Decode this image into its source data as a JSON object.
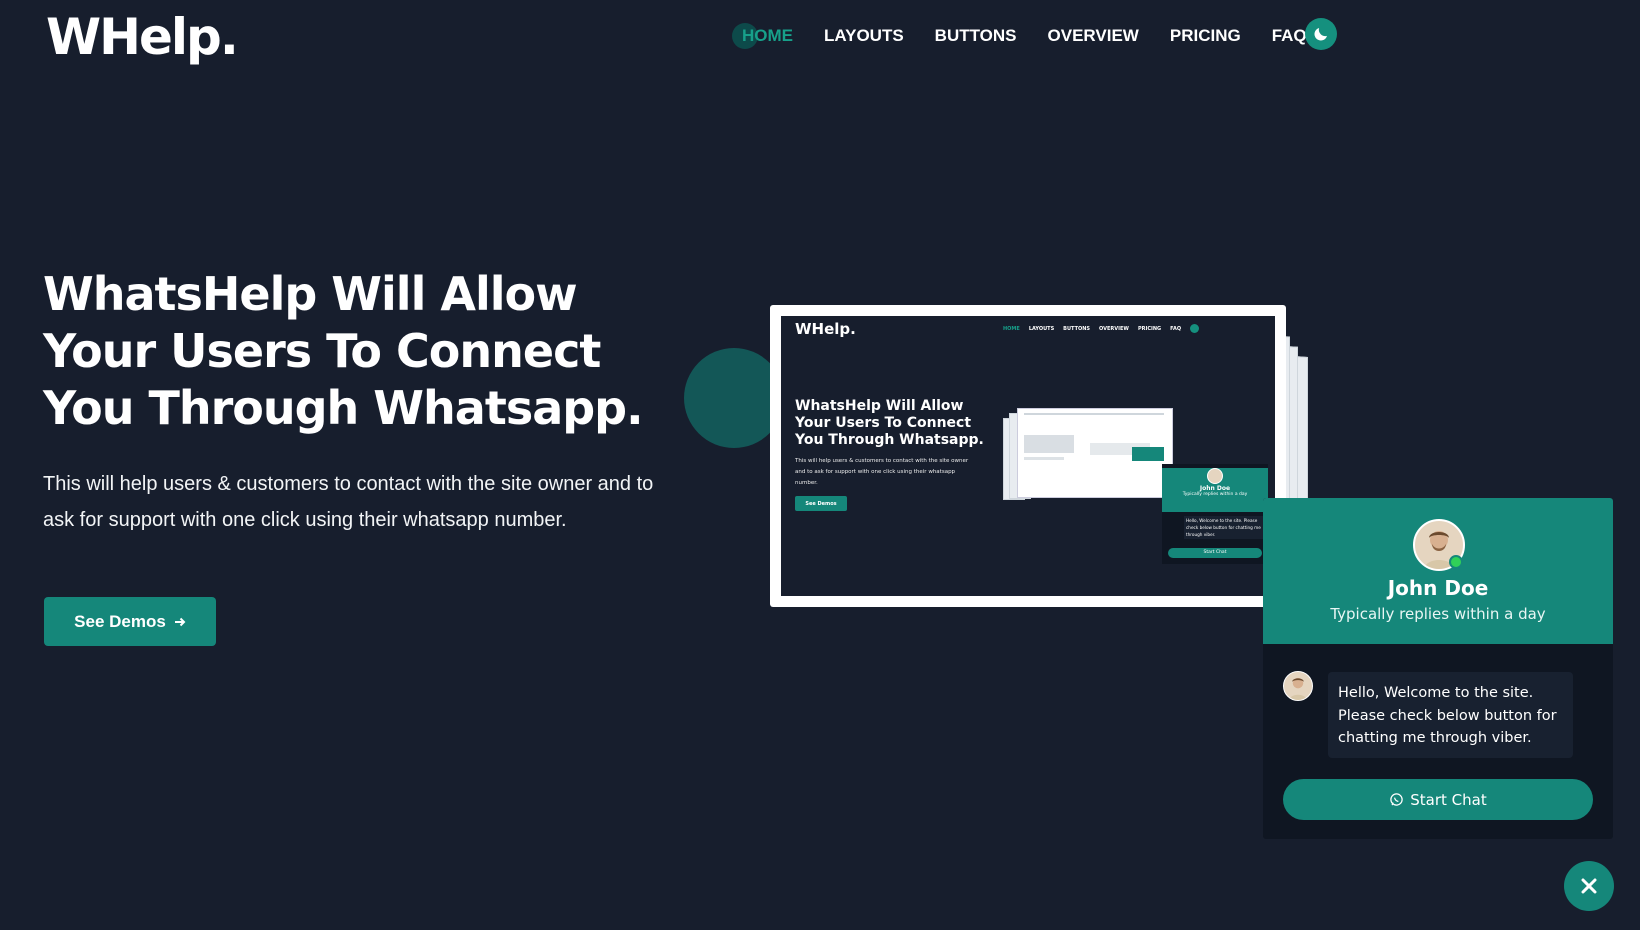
{
  "header": {
    "logo": "WHelp.",
    "nav": [
      "HOME",
      "LAYOUTS",
      "BUTTONS",
      "OVERVIEW",
      "PRICING",
      "FAQ"
    ],
    "theme_icon": "moon-icon"
  },
  "hero": {
    "title": "WhatsHelp Will Allow Your Users To Connect You Through Whatsapp.",
    "text": "This will help users & customers to contact with the site owner and to ask for support with one click using their whatsapp number.",
    "cta_label": "See Demos",
    "cta_icon": "arrow-right-icon"
  },
  "preview": {
    "logo": "WHelp.",
    "nav": [
      "HOME",
      "LAYOUTS",
      "BUTTONS",
      "OVERVIEW",
      "PRICING",
      "FAQ"
    ],
    "title": "WhatsHelp Will Allow Your Users To Connect You Through Whatsapp.",
    "text": "This will help users & customers to contact with the site owner and to ask for support with one click using their whatsapp number.",
    "cta_label": "See Demos",
    "popup_name": "John Doe",
    "popup_status": "Typically replies within a day",
    "popup_message": "Hello, Welcome to the site. Please check below button for chatting me through viber.",
    "popup_button": "Start Chat"
  },
  "chat_widget": {
    "name": "John Doe",
    "status": "Typically replies within a day",
    "message": "Hello, Welcome to the site. Please check below button for chatting me through viber.",
    "button_label": "Start Chat",
    "button_icon": "whatsapp-icon",
    "close_icon": "close-icon"
  },
  "colors": {
    "background": "#171e2d",
    "accent": "#15877a",
    "accent_light": "#17a08a",
    "panel": "#0f1622"
  }
}
